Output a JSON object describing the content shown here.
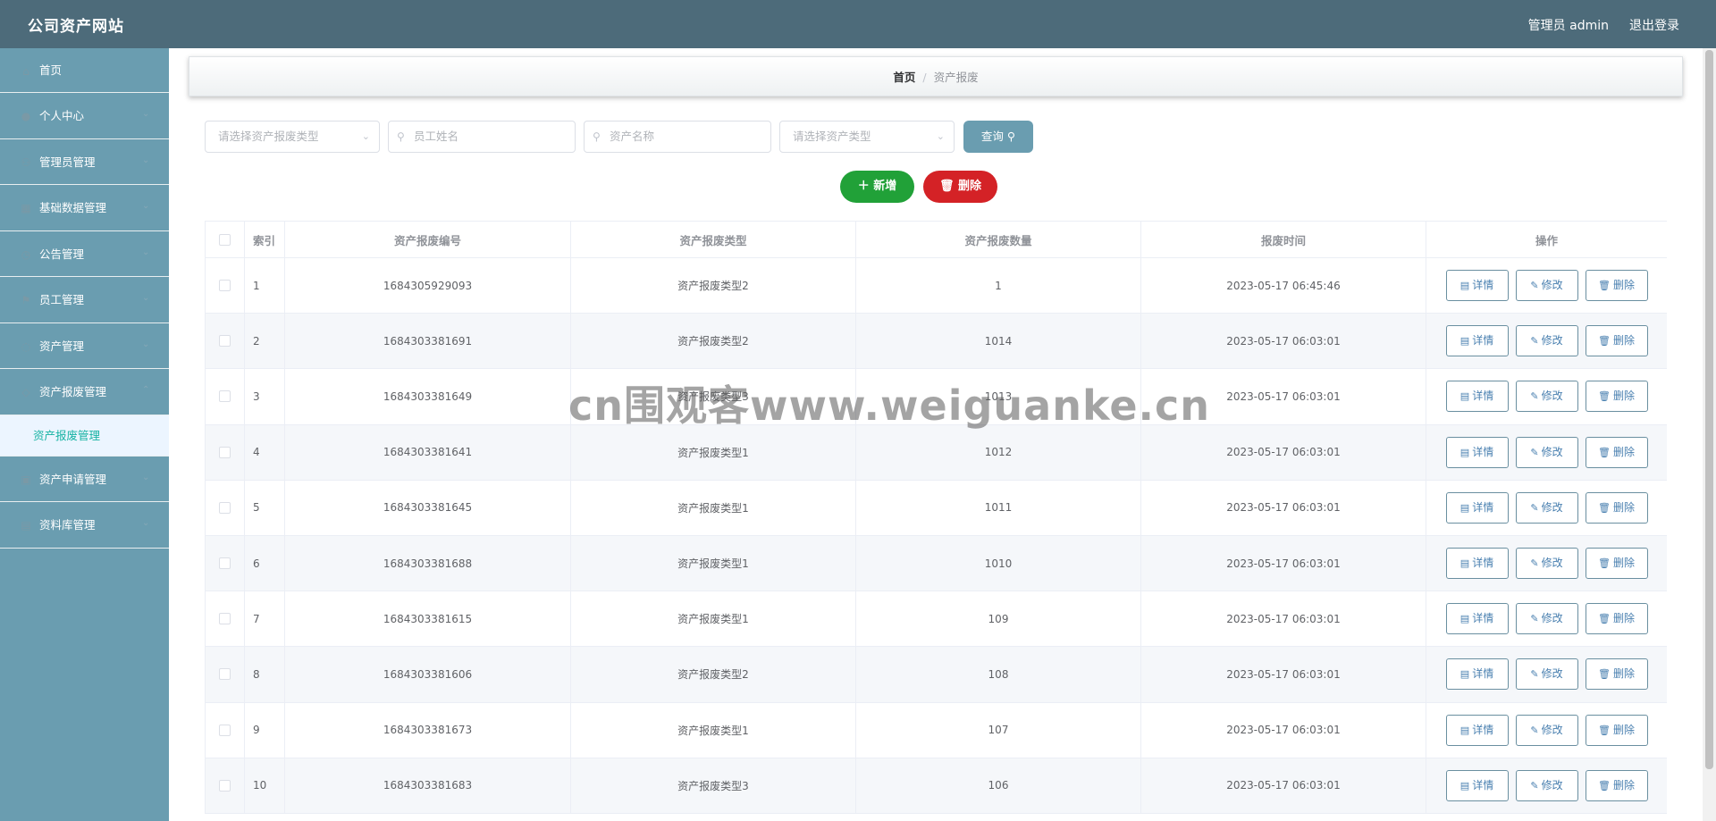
{
  "header": {
    "brand": "公司资产网站",
    "user": "管理员 admin",
    "logout": "退出登录"
  },
  "sidebar": {
    "items": [
      {
        "label": "首页",
        "icon": "home-icon"
      },
      {
        "label": "个人中心",
        "icon": "user-icon"
      },
      {
        "label": "管理员管理",
        "icon": "admin-icon"
      },
      {
        "label": "基础数据管理",
        "icon": "data-icon"
      },
      {
        "label": "公告管理",
        "icon": "notice-icon"
      },
      {
        "label": "员工管理",
        "icon": "staff-icon"
      },
      {
        "label": "资产管理",
        "icon": "asset-icon"
      },
      {
        "label": "资产报废管理",
        "icon": "scrap-icon"
      }
    ],
    "active_sub": "资产报废管理",
    "items_after": [
      {
        "label": "资产申请管理",
        "icon": "apply-icon"
      },
      {
        "label": "资料库管理",
        "icon": "library-icon"
      }
    ]
  },
  "breadcrumb": {
    "home": "首页",
    "separator": "/",
    "current": "资产报废"
  },
  "filters": {
    "scrap_type_placeholder": "请选择资产报废类型",
    "staff_name_placeholder": "员工姓名",
    "asset_name_placeholder": "资产名称",
    "asset_type_placeholder": "请选择资产类型",
    "query_label": "查询"
  },
  "actions": {
    "add_label": "新增",
    "delete_label": "删除"
  },
  "table": {
    "columns": [
      "索引",
      "资产报废编号",
      "资产报废类型",
      "资产报废数量",
      "报废时间",
      "操作"
    ],
    "row_actions": {
      "detail": "详情",
      "edit": "修改",
      "delete": "删除"
    },
    "rows": [
      {
        "index": "1",
        "code": "1684305929093",
        "type": "资产报废类型2",
        "qty": "1",
        "time": "2023-05-17 06:45:46"
      },
      {
        "index": "2",
        "code": "1684303381691",
        "type": "资产报废类型2",
        "qty": "1014",
        "time": "2023-05-17 06:03:01"
      },
      {
        "index": "3",
        "code": "1684303381649",
        "type": "资产报废类型3",
        "qty": "1013",
        "time": "2023-05-17 06:03:01"
      },
      {
        "index": "4",
        "code": "1684303381641",
        "type": "资产报废类型1",
        "qty": "1012",
        "time": "2023-05-17 06:03:01"
      },
      {
        "index": "5",
        "code": "1684303381645",
        "type": "资产报废类型1",
        "qty": "1011",
        "time": "2023-05-17 06:03:01"
      },
      {
        "index": "6",
        "code": "1684303381688",
        "type": "资产报废类型1",
        "qty": "1010",
        "time": "2023-05-17 06:03:01"
      },
      {
        "index": "7",
        "code": "1684303381615",
        "type": "资产报废类型1",
        "qty": "109",
        "time": "2023-05-17 06:03:01"
      },
      {
        "index": "8",
        "code": "1684303381606",
        "type": "资产报废类型2",
        "qty": "108",
        "time": "2023-05-17 06:03:01"
      },
      {
        "index": "9",
        "code": "1684303381673",
        "type": "资产报废类型1",
        "qty": "107",
        "time": "2023-05-17 06:03:01"
      },
      {
        "index": "10",
        "code": "1684303381683",
        "type": "资产报废类型3",
        "qty": "106",
        "time": "2023-05-17 06:03:01"
      }
    ]
  },
  "watermark": "cn围观客www.weiguanke.cn",
  "colors": {
    "topbar": "#4d6b7a",
    "sidebar": "#6a9db0",
    "accent_green": "#21a138",
    "accent_red": "#d42226",
    "active_text": "#17b3a3"
  }
}
